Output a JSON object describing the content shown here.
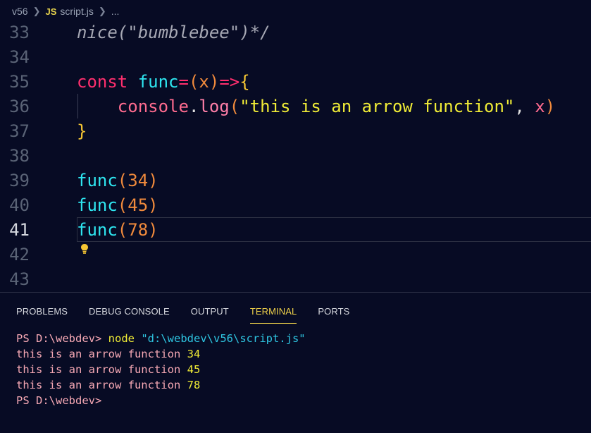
{
  "breadcrumb": {
    "folder": "v56",
    "file_badge": "JS",
    "file": "script.js",
    "more": "..."
  },
  "editor": {
    "lines": [
      {
        "num": "33",
        "tokens": [
          {
            "t": "nice(\"bumblebee\")*/",
            "c": "comment"
          }
        ]
      },
      {
        "num": "34",
        "tokens": []
      },
      {
        "num": "35",
        "tokens": [
          {
            "t": "const",
            "c": "kw"
          },
          {
            "t": " ",
            "c": "plain"
          },
          {
            "t": "func",
            "c": "fn"
          },
          {
            "t": "=",
            "c": "op"
          },
          {
            "t": "(",
            "c": "paren"
          },
          {
            "t": "x",
            "c": "param"
          },
          {
            "t": ")",
            "c": "paren"
          },
          {
            "t": "=>",
            "c": "op"
          },
          {
            "t": "{",
            "c": "brace"
          }
        ]
      },
      {
        "num": "36",
        "tokens": [
          {
            "t": "    ",
            "c": "plain"
          },
          {
            "t": "console",
            "c": "callfn"
          },
          {
            "t": ".",
            "c": "plain"
          },
          {
            "t": "log",
            "c": "method"
          },
          {
            "t": "(",
            "c": "paren"
          },
          {
            "t": "\"this is an arrow function\"",
            "c": "str"
          },
          {
            "t": ", ",
            "c": "plain"
          },
          {
            "t": "x",
            "c": "callfn"
          },
          {
            "t": ")",
            "c": "paren"
          }
        ]
      },
      {
        "num": "37",
        "tokens": [
          {
            "t": "}",
            "c": "brace"
          }
        ]
      },
      {
        "num": "38",
        "tokens": []
      },
      {
        "num": "39",
        "tokens": [
          {
            "t": "func",
            "c": "fn"
          },
          {
            "t": "(",
            "c": "paren"
          },
          {
            "t": "34",
            "c": "num"
          },
          {
            "t": ")",
            "c": "paren"
          }
        ]
      },
      {
        "num": "40",
        "tokens": [
          {
            "t": "func",
            "c": "fn"
          },
          {
            "t": "(",
            "c": "paren"
          },
          {
            "t": "45",
            "c": "num"
          },
          {
            "t": ")",
            "c": "paren"
          }
        ]
      },
      {
        "num": "41",
        "active": true,
        "tokens": [
          {
            "t": "func",
            "c": "fn"
          },
          {
            "t": "(",
            "c": "paren"
          },
          {
            "t": "78",
            "c": "num"
          },
          {
            "t": ")",
            "c": "paren"
          }
        ]
      },
      {
        "num": "42",
        "tokens": []
      },
      {
        "num": "43",
        "tokens": []
      }
    ]
  },
  "panel": {
    "tabs": [
      {
        "label": "PROBLEMS"
      },
      {
        "label": "DEBUG CONSOLE"
      },
      {
        "label": "OUTPUT"
      },
      {
        "label": "TERMINAL",
        "active": true
      },
      {
        "label": "PORTS"
      }
    ],
    "terminal": {
      "prompt1": "PS D:\\webdev>",
      "command": "node",
      "command_path": "\"d:\\webdev\\v56\\script.js\"",
      "outputs": [
        {
          "text": "this is an arrow function",
          "num": "34"
        },
        {
          "text": "this is an arrow function",
          "num": "45"
        },
        {
          "text": "this is an arrow function",
          "num": "78"
        }
      ],
      "prompt2": "PS D:\\webdev>"
    }
  },
  "colors": {
    "background": "#070b24",
    "keyword": "#ff2f6e",
    "function": "#2ee6f0",
    "string": "#f0ec36",
    "number": "#f08a3c",
    "active_tab": "#f0d24a"
  }
}
